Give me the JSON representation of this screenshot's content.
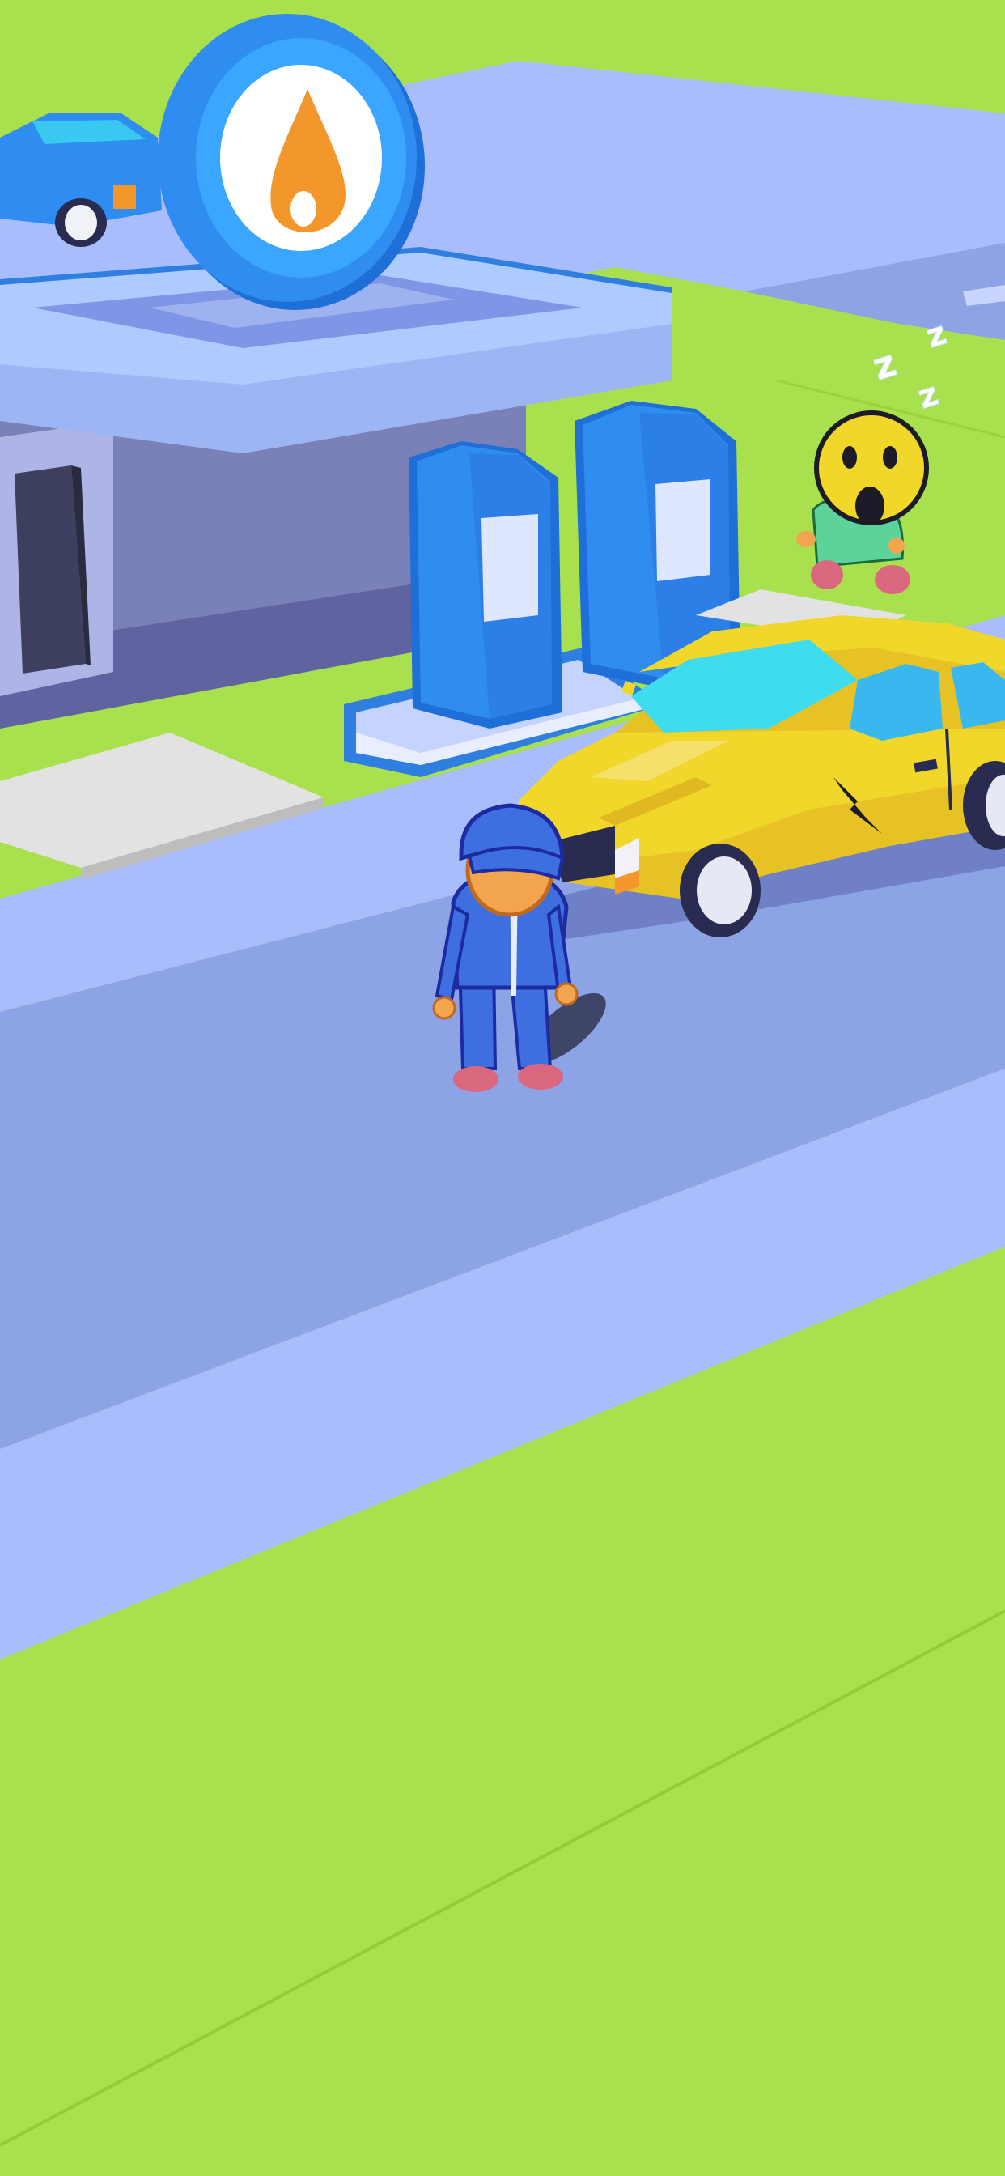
{
  "scene": {
    "sky_ground_color": "#a9e04d",
    "road_color": "#8ca4e6",
    "sidewalk_color": "#aabfff",
    "station_roof_color": "#aecbff",
    "building_wall_color": "#7a80b8",
    "pump_color": "#2f8cf0",
    "taxi_color": "#f2d72b",
    "worker_color": "#3d6fe0"
  },
  "station": {
    "sign_icon": "fuel-drop-icon",
    "sign_ring_color": "#2f8cf0",
    "sign_drop_color": "#f3962c"
  },
  "pumps": [
    {
      "name": "fuel-pump-1"
    },
    {
      "name": "fuel-pump-2"
    }
  ],
  "cars": [
    {
      "name": "parked-blue-car",
      "color": "#2f8cf0"
    },
    {
      "name": "yellow-taxi",
      "color": "#f2d72b",
      "damaged": true
    }
  ],
  "characters": [
    {
      "name": "player-mechanic",
      "outfit_color": "#3d6fe0",
      "state": "idle"
    },
    {
      "name": "sleeping-customer",
      "emoji": "surprised-face-icon",
      "state": "sleeping"
    }
  ],
  "sleep_indicator": {
    "glyphs": [
      "z",
      "z",
      "z"
    ]
  }
}
